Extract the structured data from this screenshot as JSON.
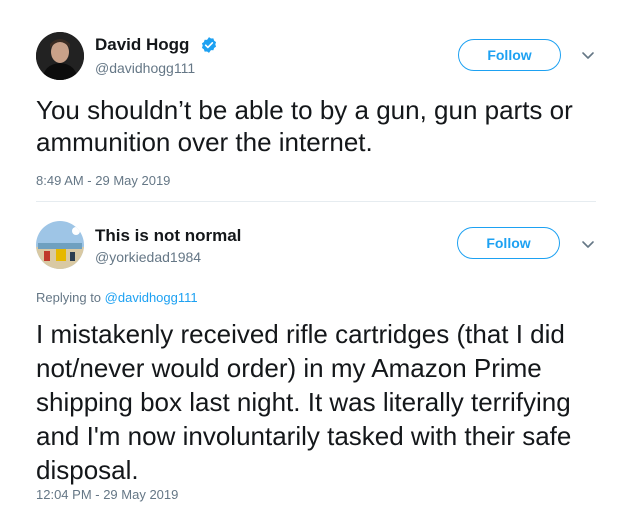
{
  "tweet": {
    "author_name": "David Hogg",
    "author_handle": "@davidhogg111",
    "follow_label": "Follow",
    "text": "You shouldn’t be able to by a gun, gun parts or ammunition over the internet.",
    "timestamp": "8:49 AM - 29 May 2019",
    "verified_icon": "verified-badge-icon"
  },
  "reply": {
    "author_name": "This is not normal",
    "author_handle": "@yorkiedad1984",
    "follow_label": "Follow",
    "replying_prefix": "Replying to",
    "replying_to": "@davidhogg111",
    "text": "I mistakenly received rifle cartridges (that I did not/never would order) in my Amazon Prime shipping box last night. It was literally terrifying and I'm now involuntarily tasked with their safe disposal.",
    "timestamp": "12:04 PM - 29 May 2019"
  },
  "colors": {
    "accent": "#1da1f2",
    "secondary_text": "#657786",
    "divider": "#e6ecf0"
  }
}
